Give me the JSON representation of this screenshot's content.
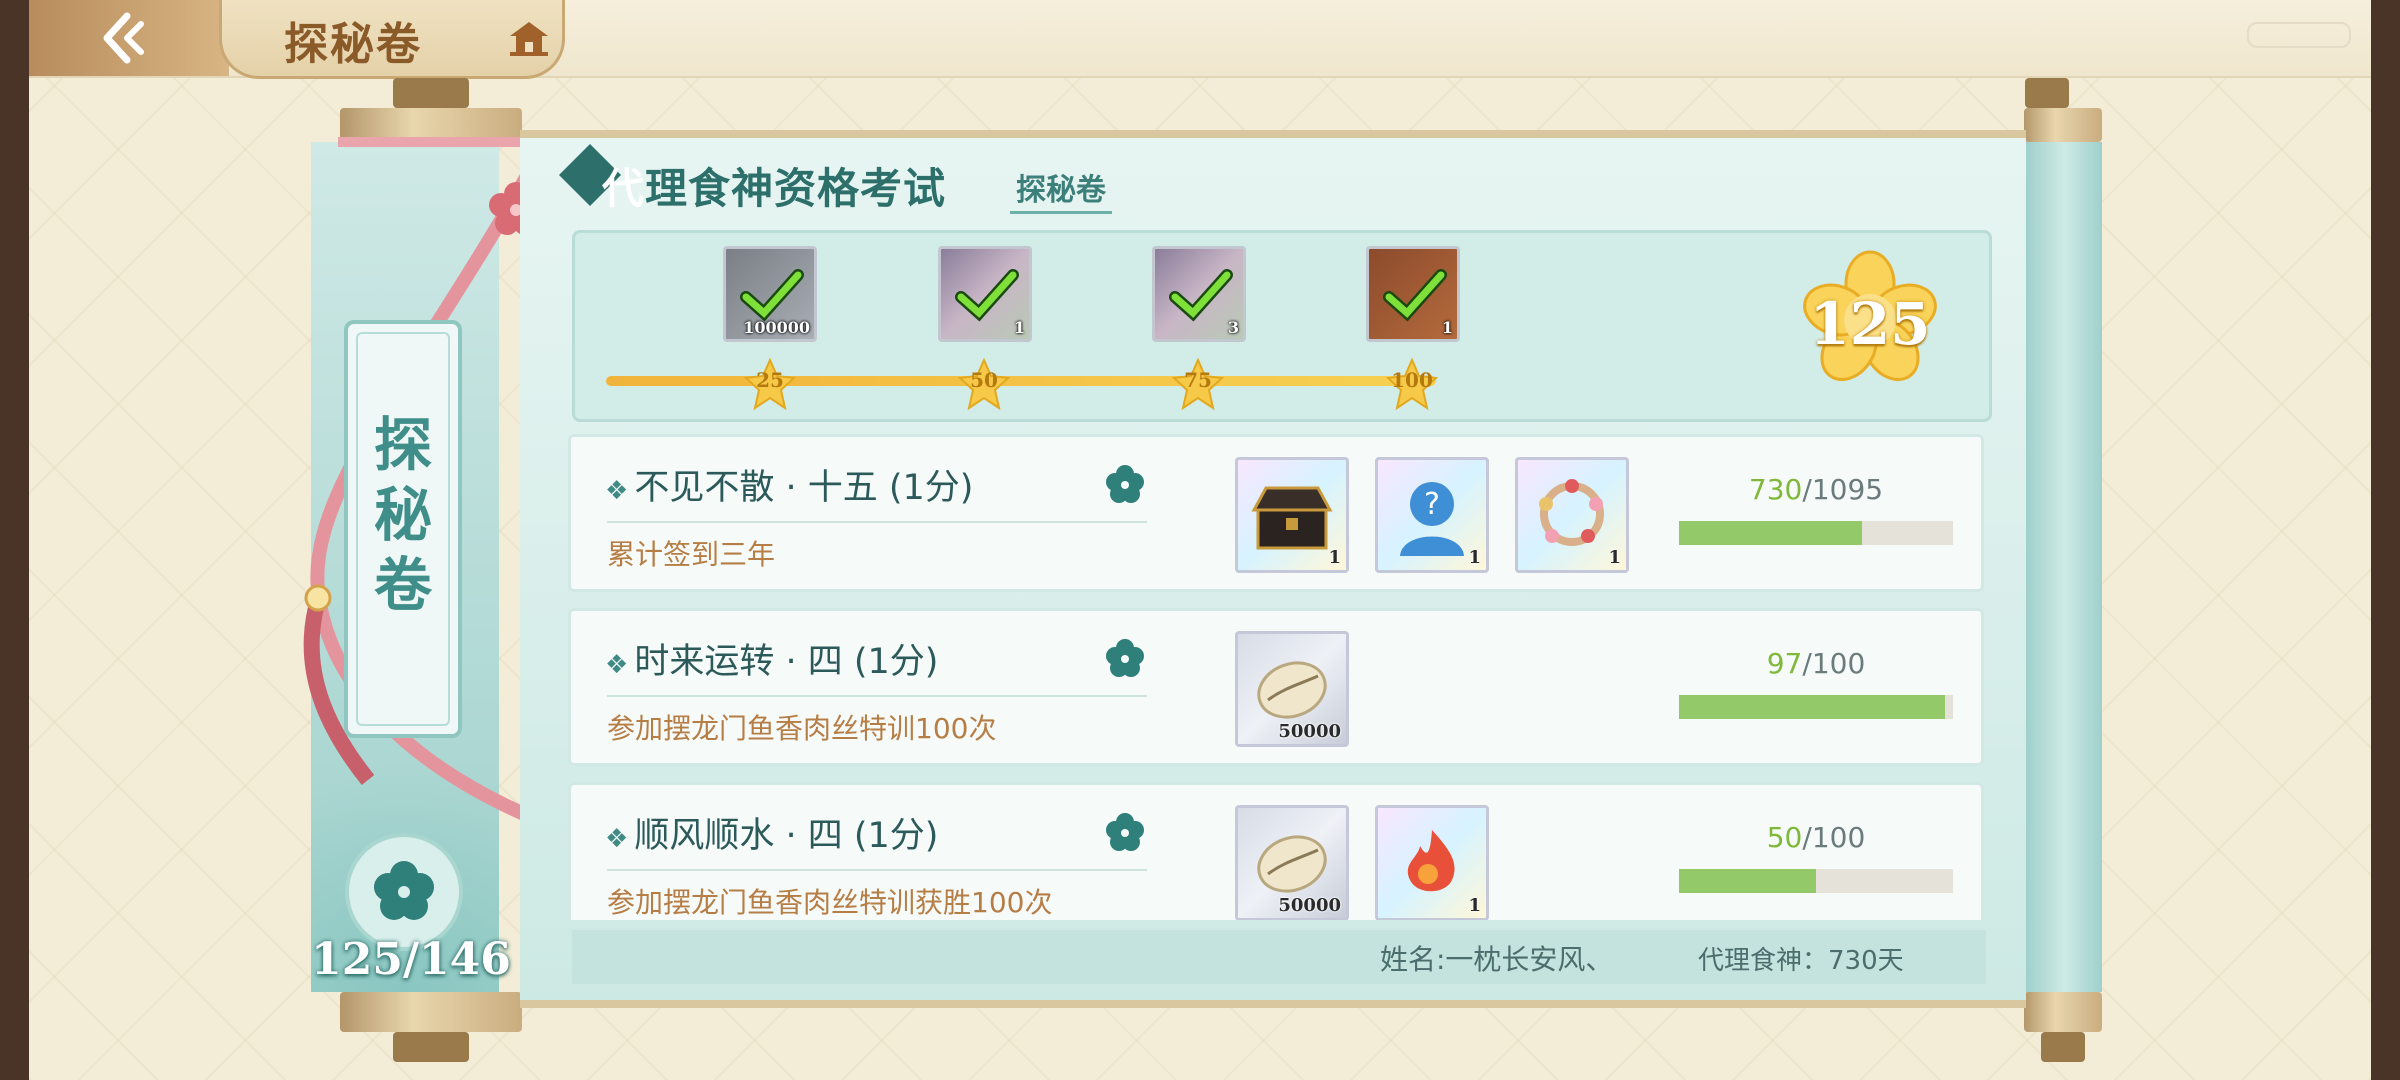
{
  "header": {
    "title": "探秘卷"
  },
  "side": {
    "title_chars": [
      "探",
      "秘",
      "卷"
    ],
    "score": "125/146"
  },
  "main": {
    "title_first_char": "代",
    "title_rest": "理食神资格考试",
    "subtitle": "探秘卷"
  },
  "milestones": {
    "current_score": "125",
    "rewards": [
      {
        "count": "100000",
        "threshold": "25",
        "claimed": true
      },
      {
        "count": "1",
        "threshold": "50",
        "claimed": true
      },
      {
        "count": "3",
        "threshold": "75",
        "claimed": true
      },
      {
        "count": "1",
        "threshold": "100",
        "claimed": true
      }
    ]
  },
  "tasks": [
    {
      "name": "不见不散 · 十五 (1分)",
      "desc": "累计签到三年",
      "current": "730",
      "sep": "/",
      "total": "1095",
      "progress": 0.667,
      "rewards": [
        {
          "count": "1",
          "icon": "lacquer-chest"
        },
        {
          "count": "1",
          "icon": "mystery-avatar"
        },
        {
          "count": "1",
          "icon": "flower-wreath"
        }
      ]
    },
    {
      "name": "时来运转 · 四 (1分)",
      "desc": "参加摆龙门鱼香肉丝特训100次",
      "current": "97",
      "sep": "/",
      "total": "100",
      "progress": 0.97,
      "rewards": [
        {
          "count": "50000",
          "icon": "cowrie-shell"
        }
      ]
    },
    {
      "name": "顺风顺水 · 四 (1分)",
      "desc": "参加摆龙门鱼香肉丝特训获胜100次",
      "current": "50",
      "sep": "/",
      "total": "100",
      "progress": 0.5,
      "rewards": [
        {
          "count": "50000",
          "icon": "cowrie-shell"
        },
        {
          "count": "1",
          "icon": "flame-spirit"
        }
      ]
    }
  ],
  "footer": {
    "name": "姓名:一枕长安风、",
    "days": "代理食神：730天"
  },
  "colors": {
    "accent_teal": "#2d6f6b",
    "progress_green": "#94c96a",
    "gold": "#f7c948"
  }
}
